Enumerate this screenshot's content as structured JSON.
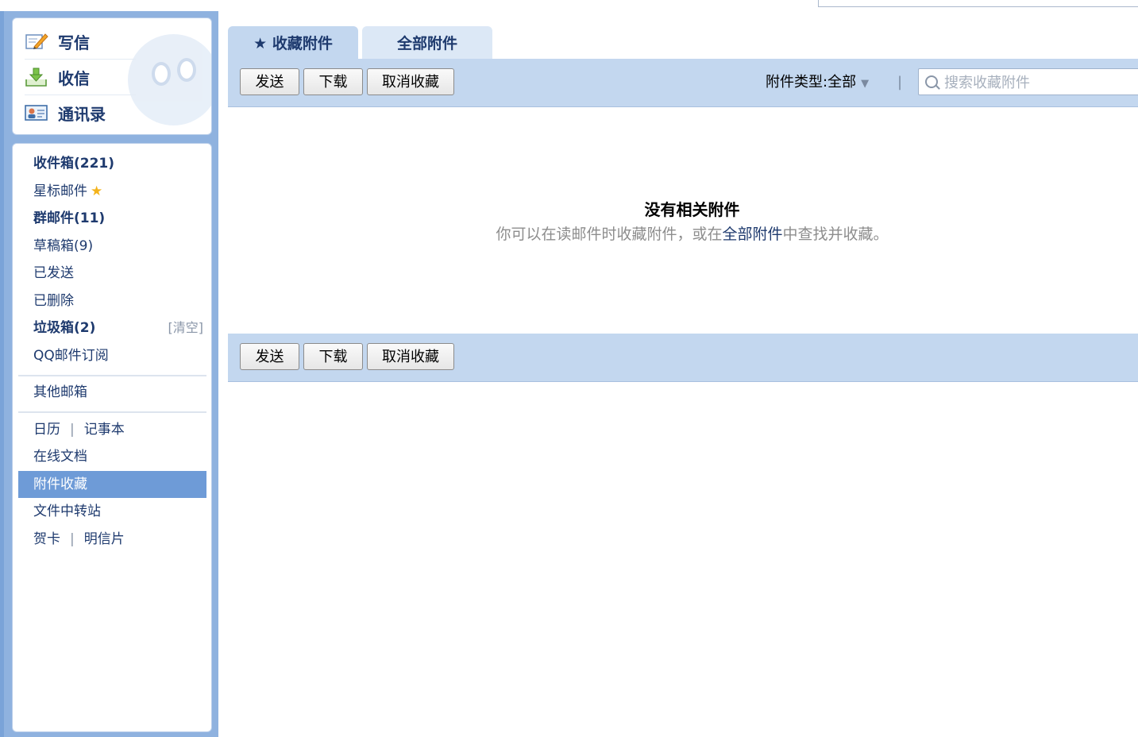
{
  "quick_actions": {
    "compose": "写信",
    "receive": "收信",
    "contacts": "通讯录"
  },
  "folders": {
    "inbox": "收件箱(221)",
    "starred": "星标邮件",
    "group": "群邮件(11)",
    "drafts": "草稿箱(9)",
    "sent": "已发送",
    "deleted": "已删除",
    "spam": "垃圾箱(2)",
    "spam_clear": "[清空]",
    "subscriptions": "QQ邮件订阅",
    "other_mailboxes": "其他邮箱",
    "calendar": "日历",
    "notepad": "记事本",
    "separator": "|",
    "online_docs": "在线文档",
    "attachment_favorites": "附件收藏",
    "file_transfer": "文件中转站",
    "greeting_cards": "贺卡",
    "postcards": "明信片"
  },
  "tabs": {
    "favorites": "★ 收藏附件",
    "all": "全部附件"
  },
  "toolbar": {
    "send": "发送",
    "download": "下载",
    "unfavorite": "取消收藏",
    "filter_label": "附件类型:",
    "filter_value": "全部",
    "filter_arrow": "▼",
    "separator": "|",
    "search_placeholder": "搜索收藏附件"
  },
  "empty_state": {
    "title": "没有相关附件",
    "desc_prefix": "你可以在读邮件时收藏附件，或在",
    "desc_link": "全部附件",
    "desc_suffix": "中查找并收藏。"
  },
  "colors": {
    "background": "#7aa3d8",
    "toolbar": "#c3d7ef",
    "active_item": "#6e9bd7",
    "link": "#1e3a6e"
  }
}
